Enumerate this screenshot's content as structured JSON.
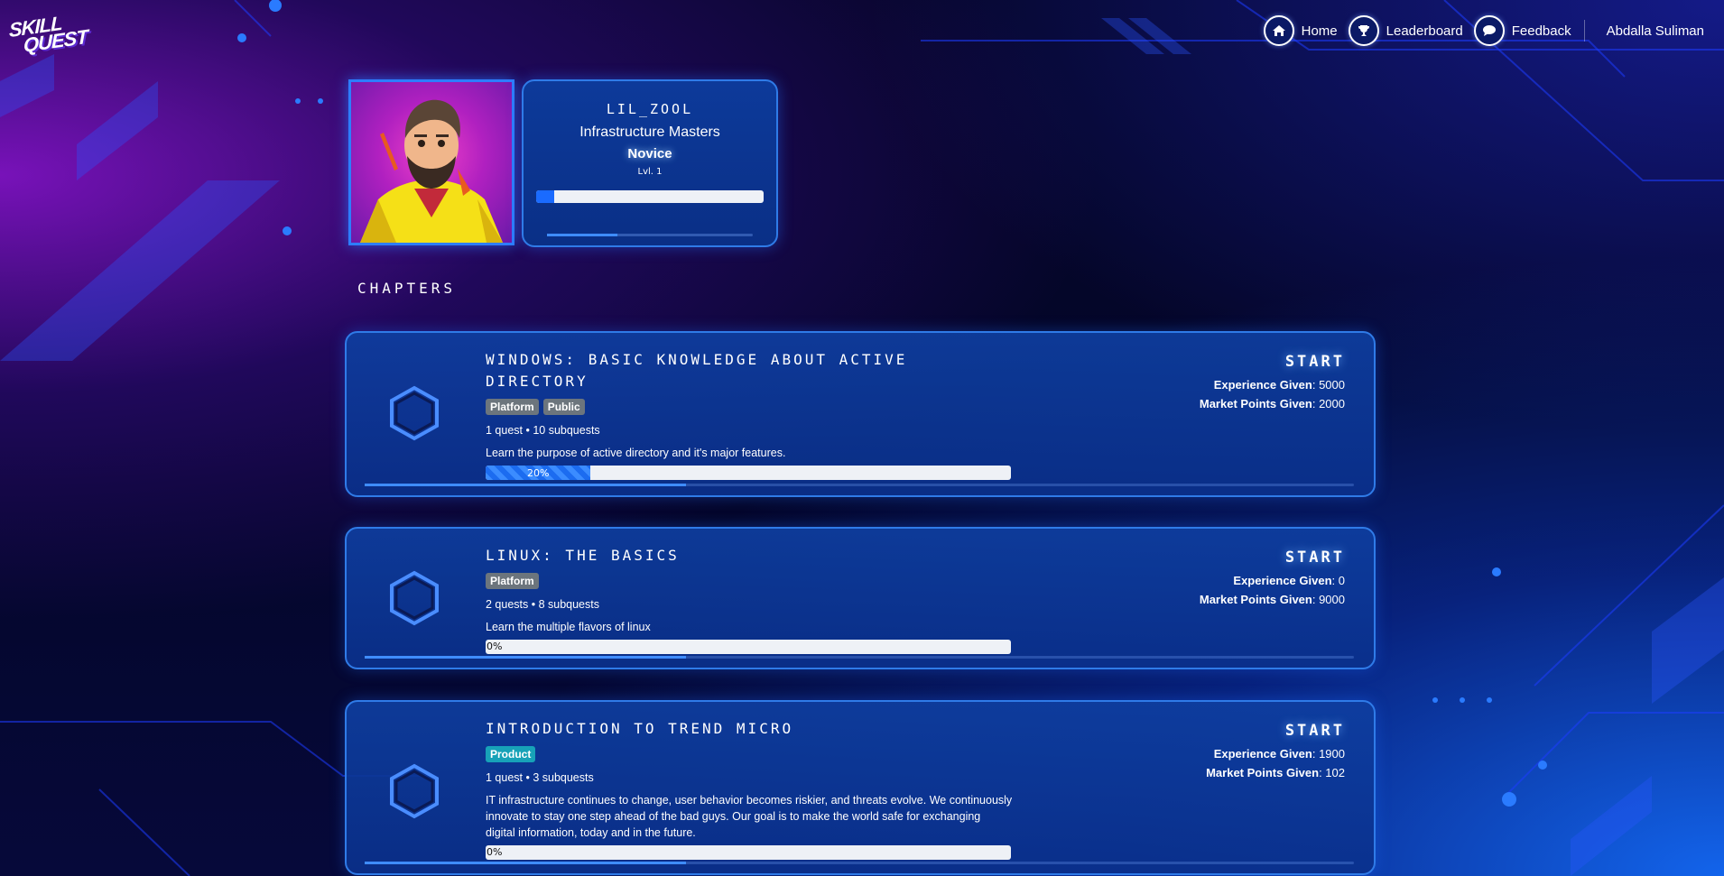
{
  "app": {
    "logo_line1": "SKILL",
    "logo_line2": "QUEST"
  },
  "nav": {
    "home": "Home",
    "leaderboard": "Leaderboard",
    "feedback": "Feedback",
    "user": "Abdalla Suliman"
  },
  "profile": {
    "username": "LIL_ZOOL",
    "team": "Infrastructure Masters",
    "rank": "Novice",
    "level": "Lvl. 1",
    "xp_progress_percent": 8
  },
  "chapters_title": "CHAPTERS",
  "chapters": [
    {
      "title": "Windows: Basic Knowledge about Active Directory",
      "tags": [
        "Platform",
        "Public"
      ],
      "meta": "1 quest • 10 subquests",
      "description": "Learn the purpose of active directory and it's major features.",
      "progress_label": "20%",
      "progress_percent": 20,
      "start": "START",
      "xp_label": "Experience Given",
      "xp_value": ": 5000",
      "mp_label": "Market Points Given",
      "mp_value": ": 2000"
    },
    {
      "title": "Linux: The Basics",
      "tags": [
        "Platform"
      ],
      "meta": "2 quests • 8 subquests",
      "description": "Learn the multiple flavors of linux",
      "progress_label": "0%",
      "progress_percent": 0,
      "start": "START",
      "xp_label": "Experience Given",
      "xp_value": ": 0",
      "mp_label": "Market Points Given",
      "mp_value": ": 9000"
    },
    {
      "title": "Introduction to Trend Micro",
      "tags": [
        "Product"
      ],
      "meta": "1 quest • 3 subquests",
      "description": "IT infrastructure continues to change, user behavior becomes riskier, and threats evolve. We continuously innovate to stay one step ahead of the bad guys. Our goal is to make the world safe for exchanging digital information, today and in the future.",
      "progress_label": "0%",
      "progress_percent": 0,
      "start": "START",
      "xp_label": "Experience Given",
      "xp_value": ": 1900",
      "mp_label": "Market Points Given",
      "mp_value": ": 102"
    }
  ],
  "colors": {
    "accent": "#2f7be8",
    "card": "#0d3a9a",
    "tag_gray": "#6c757d",
    "tag_teal": "#17a2b8"
  }
}
